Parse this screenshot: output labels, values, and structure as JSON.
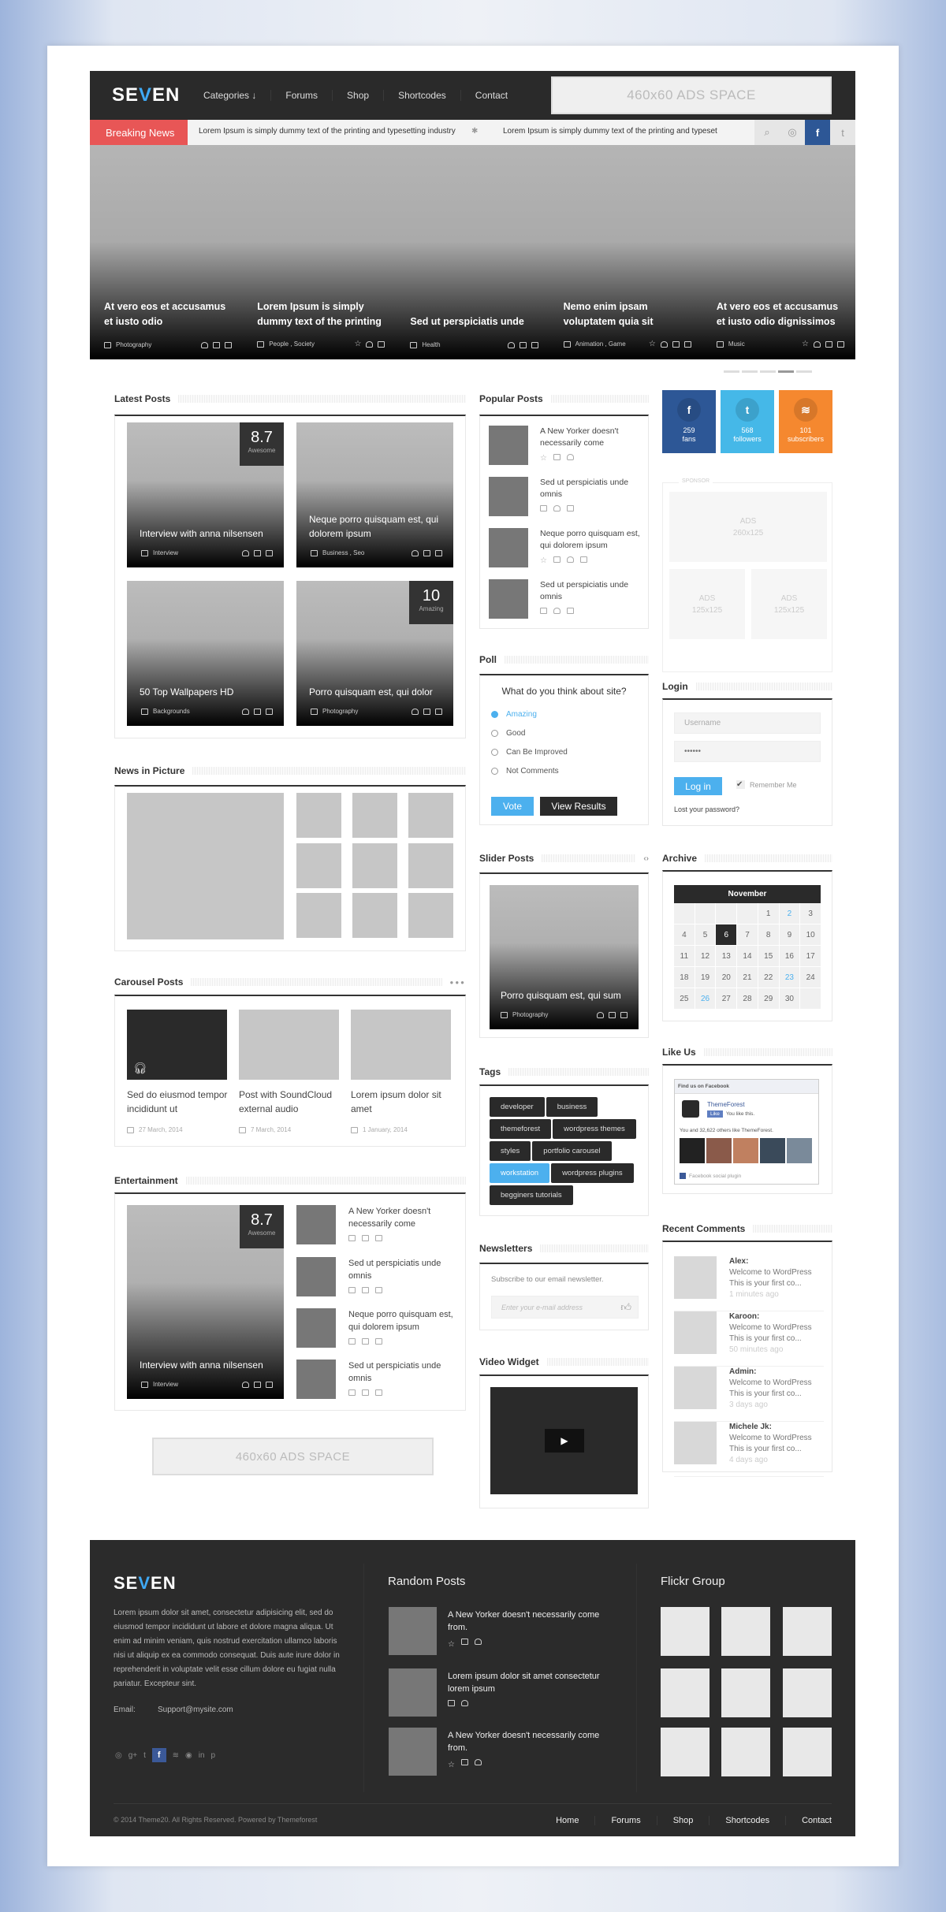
{
  "brand": {
    "logo_pre": "SE",
    "logo_accent": "V",
    "logo_post": "EN",
    "accent": "#3fa9f5"
  },
  "nav": [
    "Categories ↓",
    "Forums",
    "Shop",
    "Shortcodes",
    "Contact"
  ],
  "ads": {
    "header": "460x60 ADS SPACE",
    "content": "460x60 ADS SPACE"
  },
  "breaking": {
    "label": "Breaking News",
    "items": [
      "Lorem Ipsum is simply dummy text of the printing and typesetting industry",
      "Lorem Ipsum is simply dummy text of the printing and typesetting ind"
    ],
    "icons": [
      "search-icon",
      "dribbble-icon",
      "facebook-icon",
      "twitter-icon"
    ],
    "color": "#e85656"
  },
  "slider": [
    {
      "title": "At vero eos et accusamus et iusto odio",
      "category": "Photography",
      "icons": [
        "user",
        "calendar",
        "comment"
      ]
    },
    {
      "title": "Lorem Ipsum is simply dummy text of the printing",
      "category": "People , Society",
      "icons": [
        "star",
        "user",
        "calendar"
      ]
    },
    {
      "title": "Sed ut perspiciatis unde",
      "category": "Health",
      "icons": [
        "user",
        "calendar",
        "comment"
      ]
    },
    {
      "title": "Nemo enim ipsam voluptatem quia sit",
      "category": "Animation , Game",
      "icons": [
        "star",
        "user",
        "calendar",
        "comment"
      ]
    },
    {
      "title": "At vero eos et accusamus et iusto odio dignissimos",
      "category": "Music",
      "icons": [
        "star",
        "user",
        "calendar",
        "comment"
      ]
    }
  ],
  "latest": {
    "title": "Latest Posts",
    "posts": [
      {
        "title": "Interview with anna nilsensen",
        "category": "Interview",
        "score": "8.7",
        "score_label": "Awesome"
      },
      {
        "title": "Neque porro quisquam est, qui dolorem ipsum",
        "category": "Business , Seo"
      },
      {
        "title": "50 Top Wallpapers HD",
        "category": "Backgrounds"
      },
      {
        "title": "Porro quisquam est, qui dolor",
        "category": "Photography",
        "score": "10",
        "score_label": "Amazing"
      }
    ]
  },
  "news_picture": {
    "title": "News in Picture"
  },
  "carousel": {
    "title": "Carousel Posts",
    "posts": [
      {
        "title": "Sed do eiusmod tempor incididunt ut",
        "date": "27 March, 2014"
      },
      {
        "title": "Post with SoundCloud external audio",
        "date": "7 March, 2014"
      },
      {
        "title": "Lorem ipsum dolor sit amet",
        "date": "1 January, 2014"
      }
    ]
  },
  "entertainment": {
    "title": "Entertainment",
    "main": {
      "title": "Interview with anna nilsensen",
      "category": "Interview",
      "score": "8.7",
      "score_label": "Awesome"
    },
    "list": [
      {
        "title": "A New Yorker doesn't necessarily come"
      },
      {
        "title": "Sed ut perspiciatis unde omnis"
      },
      {
        "title": "Neque porro quisquam est, qui dolorem ipsum"
      },
      {
        "title": "Sed ut perspiciatis unde omnis"
      }
    ]
  },
  "popular": {
    "title": "Popular Posts",
    "posts": [
      {
        "title": "A New Yorker doesn't necessarily come",
        "icons": [
          "star",
          "calendar",
          "user"
        ]
      },
      {
        "title": "Sed ut perspiciatis unde omnis",
        "icons": [
          "calendar",
          "user",
          "comment"
        ]
      },
      {
        "title": "Neque porro quisquam est, qui dolorem ipsum",
        "icons": [
          "star",
          "calendar",
          "user",
          "comment"
        ]
      },
      {
        "title": "Sed ut perspiciatis unde omnis",
        "icons": [
          "calendar",
          "user",
          "comment"
        ]
      }
    ]
  },
  "poll": {
    "title": "Poll",
    "question": "What do you think about site?",
    "options": [
      "Amazing",
      "Good",
      "Can Be Improved",
      "Not Comments"
    ],
    "selected": 0,
    "vote": "Vote",
    "results": "View Results"
  },
  "slider_posts": {
    "title": "Slider Posts",
    "post": "Porro quisquam est, qui sum",
    "category": "Photography"
  },
  "tags": {
    "title": "Tags",
    "items": [
      "developer",
      "business",
      "themeforest",
      "wordpress themes",
      "styles",
      "portfolio carousel",
      "workstation",
      "wordpress plugins",
      "begginers tutorials"
    ],
    "active": "workstation"
  },
  "newsletter": {
    "title": "Newsletters",
    "text": "Subscribe to our email newsletter.",
    "placeholder": "Enter your e-mail address"
  },
  "video": {
    "title": "Video Widget"
  },
  "social": [
    {
      "count": "259",
      "label": "fans",
      "icon": "facebook-icon",
      "color": "#2d5796"
    },
    {
      "count": "568",
      "label": "followers",
      "icon": "twitter-icon",
      "color": "#45b8e8"
    },
    {
      "count": "101",
      "label": "subscribers",
      "icon": "rss-icon",
      "color": "#f5882f"
    }
  ],
  "sponsor": {
    "label": "SPONSOR",
    "ads": [
      {
        "l1": "ADS",
        "l2": "260x125"
      },
      {
        "l1": "ADS",
        "l2": "125x125"
      },
      {
        "l1": "ADS",
        "l2": "125x125"
      }
    ]
  },
  "login": {
    "title": "Login",
    "username_placeholder": "Username",
    "password_value": "••••••",
    "button": "Log in",
    "remember": "Remember Me",
    "remember_checked": true,
    "lost": "Lost your password?"
  },
  "archive": {
    "title": "Archive",
    "month": "November",
    "leading_blanks": 4,
    "days": 30,
    "today": 6,
    "highlighted": [
      2,
      23,
      26
    ]
  },
  "like": {
    "title": "Like Us",
    "header": "Find us on Facebook",
    "page": "ThemeForest",
    "like_button": "Like",
    "you_like": "You like this.",
    "others": "You and 32,622 others like ThemeForest.",
    "plugin": "Facebook social plugin"
  },
  "recent_comments": {
    "title": "Recent Comments",
    "items": [
      {
        "name": "Alex:",
        "l1": "Welcome to WordPress",
        "l2": "This is your first co...",
        "time": "1 minutes ago"
      },
      {
        "name": "Karoon:",
        "l1": "Welcome to WordPress",
        "l2": "This is your first co...",
        "time": "50 minutes ago"
      },
      {
        "name": "Admin:",
        "l1": "Welcome to WordPress",
        "l2": "This is your first co...",
        "time": "3 days ago"
      },
      {
        "name": "Michele Jk:",
        "l1": "Welcome to WordPress",
        "l2": "This is your first co...",
        "time": "4 days ago"
      }
    ]
  },
  "footer": {
    "about": "Lorem ipsum dolor sit amet, consectetur adipisicing elit, sed do eiusmod tempor incididunt ut labore et dolore magna aliqua. Ut enim ad minim veniam, quis nostrud exercitation ullamco laboris nisi ut aliquip ex ea commodo consequat. Duis aute irure dolor in reprehenderit in voluptate velit esse cillum dolore eu fugiat nulla pariatur. Excepteur sint.",
    "email_label": "Email:",
    "email": "Support@mysite.com",
    "social_icons": [
      "dribbble-icon",
      "google-plus-icon",
      "twitter-icon",
      "facebook-icon",
      "rss-icon",
      "github-icon",
      "linkedin-icon",
      "pinterest-icon"
    ],
    "random_title": "Random Posts",
    "random": [
      {
        "title": "A New Yorker doesn't necessarily come from.",
        "icons": [
          "star",
          "calendar",
          "user"
        ]
      },
      {
        "title": "Lorem ipsum dolor sit amet consectetur lorem ipsum",
        "icons": [
          "calendar",
          "user"
        ]
      },
      {
        "title": "A New Yorker doesn't necessarily come from.",
        "icons": [
          "star",
          "calendar",
          "user"
        ]
      }
    ],
    "flickr_title": "Flickr Group",
    "copyright": "© 2014 Theme20. All Rights Reserved. Powered by Themeforest",
    "nav": [
      "Home",
      "Forums",
      "Shop",
      "Shortcodes",
      "Contact"
    ]
  }
}
